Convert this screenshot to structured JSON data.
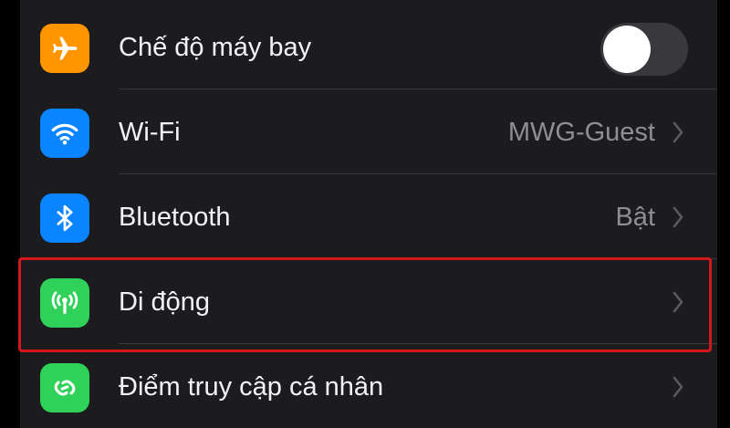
{
  "settings": {
    "rows": [
      {
        "label": "Chế độ máy bay",
        "icon": "airplane-icon",
        "color": "#ff9500",
        "control": "toggle",
        "toggle_on": false
      },
      {
        "label": "Wi-Fi",
        "value": "MWG-Guest",
        "icon": "wifi-icon",
        "color": "#0a84ff"
      },
      {
        "label": "Bluetooth",
        "value": "Bật",
        "icon": "bluetooth-icon",
        "color": "#0a84ff"
      },
      {
        "label": "Di động",
        "value": "",
        "icon": "cellular-antenna-icon",
        "color": "#30d158",
        "highlighted": true
      },
      {
        "label": "Điểm truy cập cá nhân",
        "value": "",
        "icon": "personal-hotspot-icon",
        "color": "#30d158"
      }
    ]
  },
  "colors": {
    "highlight": "#d6161e",
    "background": "#000000",
    "group_background": "#1c1c1e"
  }
}
